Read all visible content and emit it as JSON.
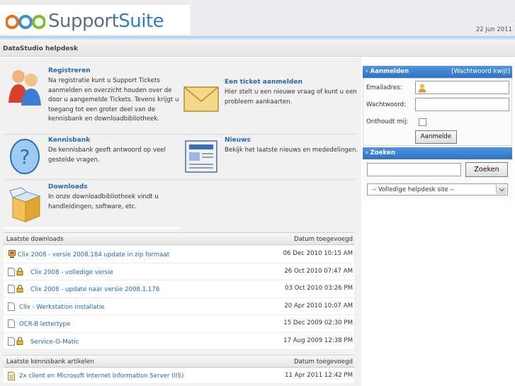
{
  "header": {
    "logo_part1": "Support",
    "logo_part2": "Suite",
    "date": "22 Jun 2011",
    "site_title": "DataStudio helpdesk"
  },
  "tiles": [
    {
      "title": "Registreren",
      "desc": "Na registratie kunt u Support Tickets aanmelden en overzicht houden over de door u aangemelde Tickets. Tevens krijgt u toegang tot een groter deel van de kennisbank en downloadbibliotheek.",
      "icon": "users-icon"
    },
    {
      "title": "Een ticket aanmelden",
      "desc": "Hier stelt u een nieuwe vraag of kunt u een probleem aankaarten.",
      "icon": "envelope-icon"
    },
    {
      "title": "Kennisbank",
      "desc": "De kennisbank geeft antwoord op veel gestelde vragen.",
      "icon": "question-icon"
    },
    {
      "title": "Nieuws",
      "desc": "Bekijk het laatste nieuws en mededelingen.",
      "icon": "news-icon"
    },
    {
      "title": "Downloads",
      "desc": "In onze downloadbibliotheek vindt u handleidingen, software, etc.",
      "icon": "box-icon"
    }
  ],
  "downloads": {
    "header_left": "Laatste downloads",
    "header_right": "Datum toegevoegd",
    "items": [
      {
        "name": "Clix 2008 - versie 2008.184 update in zip formaat",
        "date": "06 Dec 2010 10:15 AM",
        "icon": "computer-icon",
        "locked": false
      },
      {
        "name": "Clix 2008 - volledige versie",
        "date": "26 Oct 2010 07:47 AM",
        "icon": "file-icon",
        "locked": true
      },
      {
        "name": "Clix 2008 - update naar versie 2008.1.178",
        "date": "03 Oct 2010 03:26 PM",
        "icon": "file-icon",
        "locked": true
      },
      {
        "name": "Clix - Werkstation installatie",
        "date": "20 Apr 2010 10:07 AM",
        "icon": "file-icon",
        "locked": false
      },
      {
        "name": "OCR-B lettertype",
        "date": "15 Dec 2009 02:30 PM",
        "icon": "file-icon",
        "locked": false
      },
      {
        "name": "Service-O-Matic",
        "date": "17 Aug 2009 12:38 PM",
        "icon": "file-icon",
        "locked": true
      }
    ]
  },
  "kb": {
    "header_left": "Laatste kennisbank artikelen",
    "header_right": "Datum toegevoegd",
    "items": [
      {
        "name": "2x client en Microsoft Internet Information Server (IIS)",
        "date": "11 Apr 2011 12:42 PM",
        "icon": "article-icon"
      }
    ]
  },
  "login": {
    "title": "Aanmelden",
    "forgot": "[Wachtwoord kwijt]",
    "email_label": "Emailadres:",
    "password_label": "Wachtwoord:",
    "remember_label": "Onthoudt mij:",
    "submit": "Aanmelde"
  },
  "search": {
    "title": "Zoeken",
    "button": "Zoeken",
    "scope": "-- Volledige helpdesk site --"
  },
  "colors": {
    "link": "#2567b7",
    "sidebar_bar": "#3a7fd0",
    "brand_blue": "#2e7fcb"
  }
}
